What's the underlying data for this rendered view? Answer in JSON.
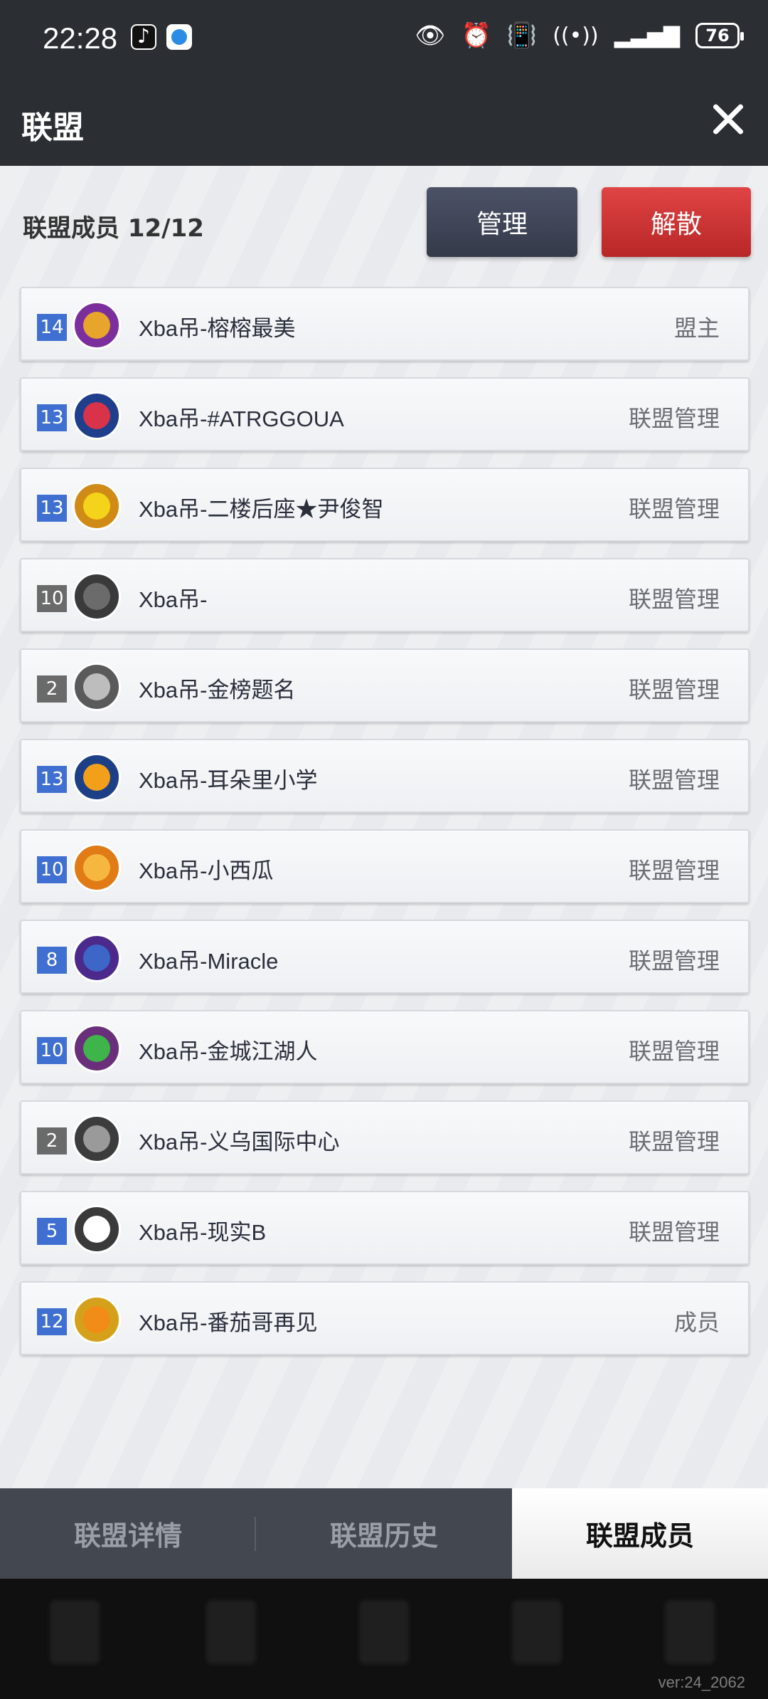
{
  "status_bar": {
    "time": "22:28",
    "battery": "76",
    "icons": [
      "tiktok-icon",
      "browser-icon",
      "eye-icon",
      "alarm-icon",
      "vibrate-icon",
      "wifi-icon",
      "signal-icon",
      "battery-icon"
    ]
  },
  "header": {
    "title": "联盟"
  },
  "panel": {
    "members_label": "联盟成员 12/12",
    "manage_button": "管理",
    "disband_button": "解散"
  },
  "members": [
    {
      "level": "14",
      "level_color": "blue",
      "name": "Xba吊-榕榕最美",
      "role": "盟主",
      "badge": {
        "ring": "#7b2f9c",
        "inner": "#e8a52c"
      }
    },
    {
      "level": "13",
      "level_color": "blue",
      "name": "Xba吊-#ATRGGOUA",
      "role": "联盟管理",
      "badge": {
        "ring": "#1f3f8c",
        "inner": "#d9334a"
      }
    },
    {
      "level": "13",
      "level_color": "blue",
      "name": "Xba吊-二楼后座★尹俊智",
      "role": "联盟管理",
      "badge": {
        "ring": "#d08b16",
        "inner": "#f3d41a"
      }
    },
    {
      "level": "10",
      "level_color": "gray",
      "name": "Xba吊-",
      "role": "联盟管理",
      "badge": {
        "ring": "#3a3a3a",
        "inner": "#6b6b6b"
      }
    },
    {
      "level": "2",
      "level_color": "gray",
      "name": "Xba吊-金榜题名",
      "role": "联盟管理",
      "badge": {
        "ring": "#5a5a5a",
        "inner": "#bdbdbd"
      }
    },
    {
      "level": "13",
      "level_color": "blue",
      "name": "Xba吊-耳朵里小学",
      "role": "联盟管理",
      "badge": {
        "ring": "#1c3f86",
        "inner": "#f2a019"
      }
    },
    {
      "level": "10",
      "level_color": "blue",
      "name": "Xba吊-小西瓜",
      "role": "联盟管理",
      "badge": {
        "ring": "#e07b16",
        "inner": "#f6b740"
      }
    },
    {
      "level": "8",
      "level_color": "blue",
      "name": "Xba吊-Miracle",
      "role": "联盟管理",
      "badge": {
        "ring": "#4b2a8c",
        "inner": "#3d67c6"
      }
    },
    {
      "level": "10",
      "level_color": "blue",
      "name": "Xba吊-金城江湖人",
      "role": "联盟管理",
      "badge": {
        "ring": "#6a2f7a",
        "inner": "#3fb44a"
      }
    },
    {
      "level": "2",
      "level_color": "gray",
      "name": "Xba吊-义乌国际中心",
      "role": "联盟管理",
      "badge": {
        "ring": "#3c3c3c",
        "inner": "#9a9a9a"
      }
    },
    {
      "level": "5",
      "level_color": "blue",
      "name": "Xba吊-现实B",
      "role": "联盟管理",
      "badge": {
        "ring": "#3a3a3a",
        "inner": "#ffffff"
      }
    },
    {
      "level": "12",
      "level_color": "blue",
      "name": "Xba吊-番茄哥再见",
      "role": "成员",
      "badge": {
        "ring": "#d6a11a",
        "inner": "#f08c17"
      }
    }
  ],
  "tabs": [
    {
      "label": "联盟详情",
      "active": false
    },
    {
      "label": "联盟历史",
      "active": false
    },
    {
      "label": "联盟成员",
      "active": true
    }
  ],
  "version": "ver:24_2062"
}
